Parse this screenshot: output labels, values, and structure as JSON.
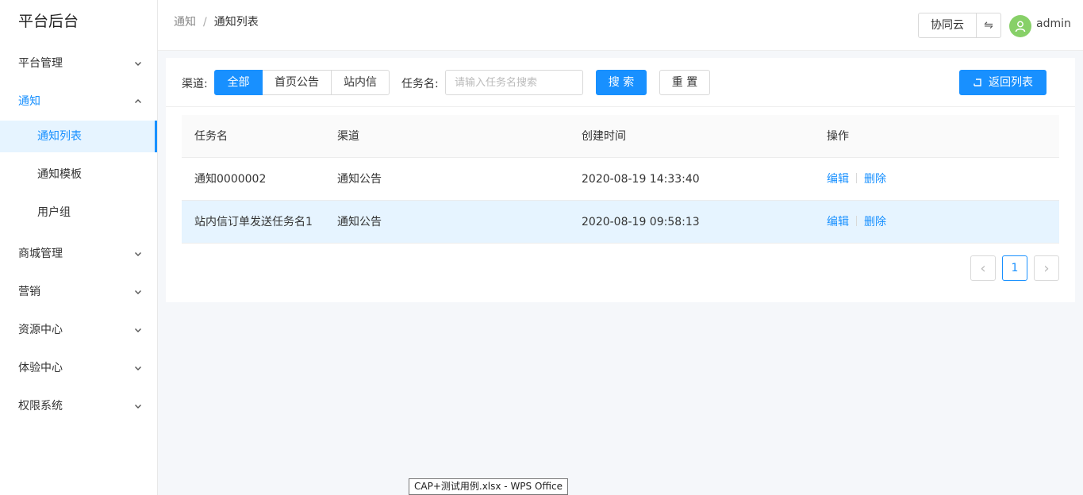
{
  "sidebar": {
    "brand": "平台后台",
    "menu": [
      {
        "label": "平台管理"
      },
      {
        "label": "通知"
      },
      {
        "label": "商城管理"
      },
      {
        "label": "营销"
      },
      {
        "label": "资源中心"
      },
      {
        "label": "体验中心"
      },
      {
        "label": "权限系统"
      }
    ],
    "notify_sub": [
      {
        "label": "通知列表"
      },
      {
        "label": "通知模板"
      },
      {
        "label": "用户组"
      }
    ]
  },
  "header": {
    "breadcrumb": [
      "通知",
      "通知列表"
    ],
    "breadcrumb_sep": "/",
    "tenant": "协同云",
    "swap_symbol": "⇋",
    "user": "admin"
  },
  "filters": {
    "channel_label": "渠道:",
    "channels": [
      "全部",
      "首页公告",
      "站内信"
    ],
    "selected_channel": "全部",
    "task_label": "任务名:",
    "task_placeholder": "请输入任务名搜索",
    "task_value": "",
    "search_btn": "搜 索",
    "reset_btn": "重 置",
    "back_btn": "返回列表"
  },
  "table": {
    "columns": [
      "任务名",
      "渠道",
      "创建时间",
      "操作"
    ],
    "rows": [
      {
        "name": "通知0000002",
        "channel": "通知公告",
        "created": "2020-08-19 14:33:40",
        "edit": "编辑",
        "delete": "删除"
      },
      {
        "name": "站内信订单发送任务名1",
        "channel": "通知公告",
        "created": "2020-08-19 09:58:13",
        "edit": "编辑",
        "delete": "删除"
      }
    ]
  },
  "pagination": {
    "current": "1",
    "prev_symbol": "‹",
    "next_symbol": "›"
  },
  "taskbar_tooltip": "CAP+测试用例.xlsx - WPS Office",
  "colors": {
    "primary": "#1890ff",
    "avatar": "#87d068",
    "row_highlight": "#e6f4ff"
  }
}
